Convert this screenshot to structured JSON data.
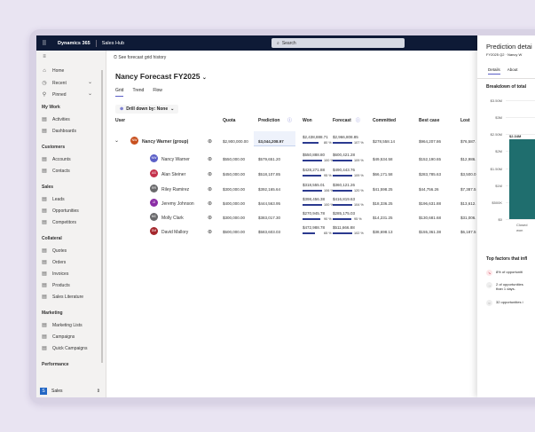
{
  "topbar": {
    "app": "Dynamics 365",
    "area": "Sales Hub",
    "search_placeholder": "Search"
  },
  "sidebar": {
    "top": [
      {
        "label": "Home",
        "icon": "home-icon"
      },
      {
        "label": "Recent",
        "icon": "clock-icon"
      },
      {
        "label": "Pinned",
        "icon": "pin-icon"
      }
    ],
    "groups": [
      {
        "label": "My Work",
        "items": [
          "Activities",
          "Dashboards"
        ]
      },
      {
        "label": "Customers",
        "items": [
          "Accounts",
          "Contacts"
        ]
      },
      {
        "label": "Sales",
        "items": [
          "Leads",
          "Opportunities",
          "Competitors"
        ]
      },
      {
        "label": "Collateral",
        "items": [
          "Quotes",
          "Orders",
          "Invoices",
          "Products",
          "Sales Literature"
        ]
      },
      {
        "label": "Marketing",
        "items": [
          "Marketing Lists",
          "Campaigns",
          "Quick Campaigns"
        ]
      },
      {
        "label": "Performance",
        "items": []
      }
    ],
    "area": {
      "initial": "S",
      "label": "Sales"
    }
  },
  "main": {
    "history_link": "See forecast grid history",
    "title": "Nancy Forecast FY2025",
    "tabs": [
      "Grid",
      "Trend",
      "Flow"
    ],
    "drill": "Drill down by: None",
    "columns": [
      "User",
      "Quota",
      "Prediction",
      "Won",
      "Forecast",
      "Committed",
      "Best case",
      "Lost"
    ],
    "rows": [
      {
        "initials": "NW",
        "color": "#c8501e",
        "name": "Nancy Warner (group)",
        "quota": "$2,900,000.00",
        "prediction": "$3,044,208.97",
        "won": "$2,438,888.71",
        "won_pct": "80 %",
        "won_frac": 0.8,
        "forecast": "$2,966,808.85",
        "forecast_pct": "107 %",
        "forecast_frac": 1.0,
        "committed": "$278,558.14",
        "best": "$964,207.86",
        "lost": "$76,587.",
        "group": true
      },
      {
        "initials": "NW",
        "color": "#5b5fc7",
        "name": "Nancy Warner",
        "quota": "$550,000.00",
        "prediction": "$579,651.20",
        "won": "$550,888.80",
        "won_pct": "100 %",
        "won_frac": 1.0,
        "forecast": "$600,421.28",
        "forecast_pct": "109 %",
        "forecast_frac": 1.0,
        "committed": "$49,534.58",
        "best": "$152,190.65",
        "lost": "$12,986."
      },
      {
        "initials": "AS",
        "color": "#c4314b",
        "name": "Alan Steiner",
        "quota": "$450,000.00",
        "prediction": "$518,107.85",
        "won": "$428,271.88",
        "won_pct": "95 %",
        "won_frac": 0.95,
        "forecast": "$490,443.76",
        "forecast_pct": "109 %",
        "forecast_frac": 1.0,
        "committed": "$66,171.58",
        "best": "$283,785.63",
        "lost": "$3,500.0"
      },
      {
        "initials": "RR",
        "color": "#69696b",
        "name": "Riley Ramirez",
        "quota": "$300,000.00",
        "prediction": "$392,165.64",
        "won": "$318,555.01",
        "won_pct": "106 %",
        "won_frac": 1.0,
        "forecast": "$360,121.26",
        "forecast_pct": "120 %",
        "forecast_frac": 1.0,
        "committed": "$41,598.25",
        "best": "$44,756.26",
        "lost": "$7,387.5"
      },
      {
        "initials": "JJ",
        "color": "#8a2da5",
        "name": "Jeremy Johnson",
        "quota": "$400,000.00",
        "prediction": "$444,563.95",
        "won": "$398,456.38",
        "won_pct": "100 %",
        "won_frac": 1.0,
        "forecast": "$416,819.63",
        "forecast_pct": "104 %",
        "forecast_frac": 1.0,
        "committed": "$18,336.25",
        "best": "$196,631.88",
        "lost": "$13,612."
      },
      {
        "initials": "MC",
        "color": "#69696b",
        "name": "Molly Clark",
        "quota": "$300,000.00",
        "prediction": "$383,017.30",
        "won": "$270,945.78",
        "won_pct": "90 %",
        "won_frac": 0.9,
        "forecast": "$285,175.03",
        "forecast_pct": "95 %",
        "forecast_frac": 0.95,
        "committed": "$14,231.25",
        "best": "$130,681.68",
        "lost": "$31,006."
      },
      {
        "initials": "DM",
        "color": "#a4262c",
        "name": "David Mallory",
        "quota": "$500,000.00",
        "prediction": "$583,603.03",
        "won": "$472,988.78",
        "won_pct": "65 %",
        "won_frac": 0.65,
        "forecast": "$511,666.88",
        "forecast_pct": "102 %",
        "forecast_frac": 1.0,
        "committed": "$38,698.13",
        "best": "$155,361.38",
        "lost": "$6,187.5"
      }
    ]
  },
  "panel": {
    "title": "Prediction detai",
    "subtitle": "FY2025 Q2 · Nancy W",
    "tabs": [
      "Details",
      "About"
    ],
    "breakdown": "Breakdown of total",
    "chart_data": {
      "type": "bar",
      "categories": [
        "Closed won"
      ],
      "category_lines": [
        "Closed",
        "won"
      ],
      "values": [
        2.34
      ],
      "data_labels": [
        "$2.34M"
      ],
      "yticks": [
        "$3.50M",
        "$3M",
        "$2.50M",
        "$2M",
        "$1.50M",
        "$1M",
        "$500K",
        "$0"
      ],
      "ylim": [
        0,
        3.5
      ]
    },
    "factors_title": "Top factors that infl",
    "factors": [
      {
        "icon": "trend-down-icon",
        "text": "8% of opportuniti"
      },
      {
        "icon": "arrow-right-icon",
        "text": "2 of opportunities",
        "text2": "than 1 days."
      },
      {
        "icon": "circle-icon",
        "text": "32 opportunities i"
      }
    ]
  },
  "colors": {
    "topbar": "#0e1a36",
    "accent": "#5b5fc7",
    "bar": "#1f6e6e",
    "progress": "#2b3a8f"
  }
}
